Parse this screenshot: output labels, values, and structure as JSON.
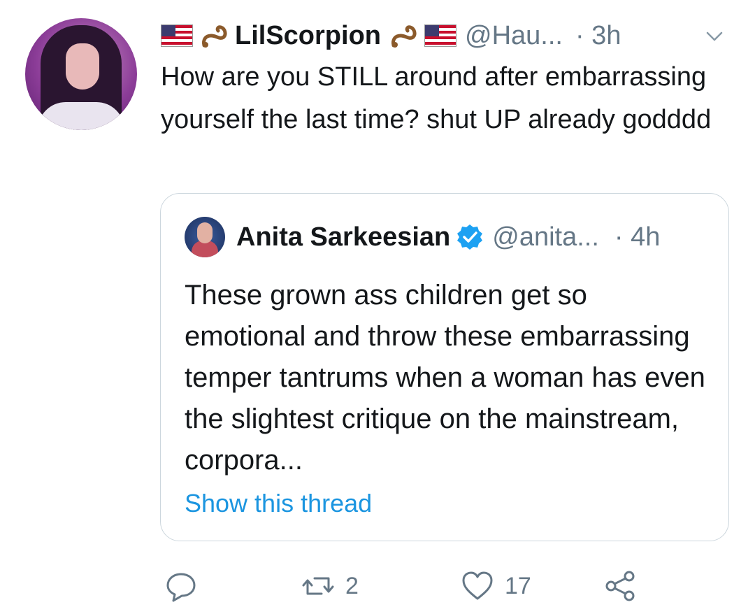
{
  "tweet": {
    "author": {
      "display_name": "LilScorpion",
      "handle": "@Hau...",
      "flag_icon": "us-flag-icon",
      "emoji_icon": "scorpion-icon"
    },
    "time": "· 3h",
    "text": "How are you STILL around after embarrassing yourself the last time? shut UP already godddd"
  },
  "quoted_tweet": {
    "author": {
      "display_name": "Anita Sarkeesian",
      "handle": "@anita...",
      "verified": true
    },
    "time": "· 4h",
    "text": "These grown ass children get so emotional and throw these embarrassing temper tantrums when a woman has even the slightest critique on the mainstream, corpora...",
    "show_thread_label": "Show this thread"
  },
  "actions": {
    "reply_count": "",
    "retweet_count": "2",
    "like_count": "17"
  },
  "colors": {
    "text": "#14171a",
    "secondary": "#657786",
    "link": "#1b95e0",
    "border": "#ccd6dd",
    "verified": "#1da1f2"
  }
}
